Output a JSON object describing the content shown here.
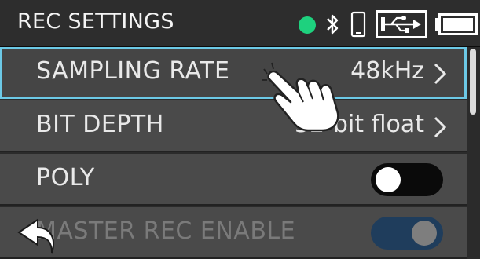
{
  "header": {
    "title": "REC SETTINGS",
    "status_icons": [
      "green-status-dot-icon",
      "bluetooth-icon",
      "phone-icon",
      "usb-icon",
      "battery-icon"
    ],
    "status_dot_color": "#1ed17e"
  },
  "menu": {
    "items": [
      {
        "label": "SAMPLING RATE",
        "value": "48kHz",
        "selected": true
      },
      {
        "label": "BIT DEPTH",
        "value": "32-bit float"
      },
      {
        "label": "POLY",
        "toggle": "off"
      },
      {
        "label": "MASTER REC ENABLE",
        "toggle": "on",
        "disabled": true
      }
    ]
  },
  "colors": {
    "accent": "#6cc9e6",
    "row_bg": "#4a4a4a",
    "toggle_on": "#1f3d5c"
  },
  "footer": {
    "back_icon": "back-arrow-icon"
  },
  "overlay": {
    "icon": "touch-hand-icon"
  }
}
